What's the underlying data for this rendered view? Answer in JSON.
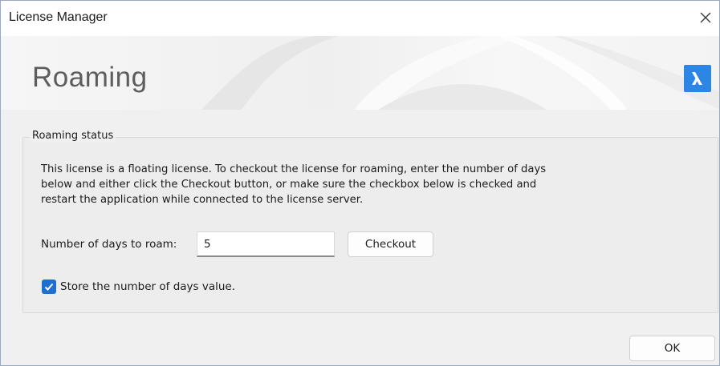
{
  "window": {
    "title": "License Manager",
    "close_icon": "close-icon"
  },
  "banner": {
    "title": "Roaming",
    "logo_icon": "bricscad-logo-icon",
    "logo_color": "#2d86e3"
  },
  "roaming_status": {
    "group_label": "Roaming status",
    "description": "This license is a floating license. To checkout the license for roaming, enter the number of days below and either click the Checkout button, or make sure the checkbox below is checked and restart the application while connected to the license server.",
    "days_label": "Number of days to roam:",
    "days_value": "5",
    "checkout_label": "Checkout",
    "store_checkbox": {
      "checked": true,
      "label": "Store the number of days value.",
      "color": "#1f6fcf"
    }
  },
  "footer": {
    "ok_label": "OK"
  }
}
